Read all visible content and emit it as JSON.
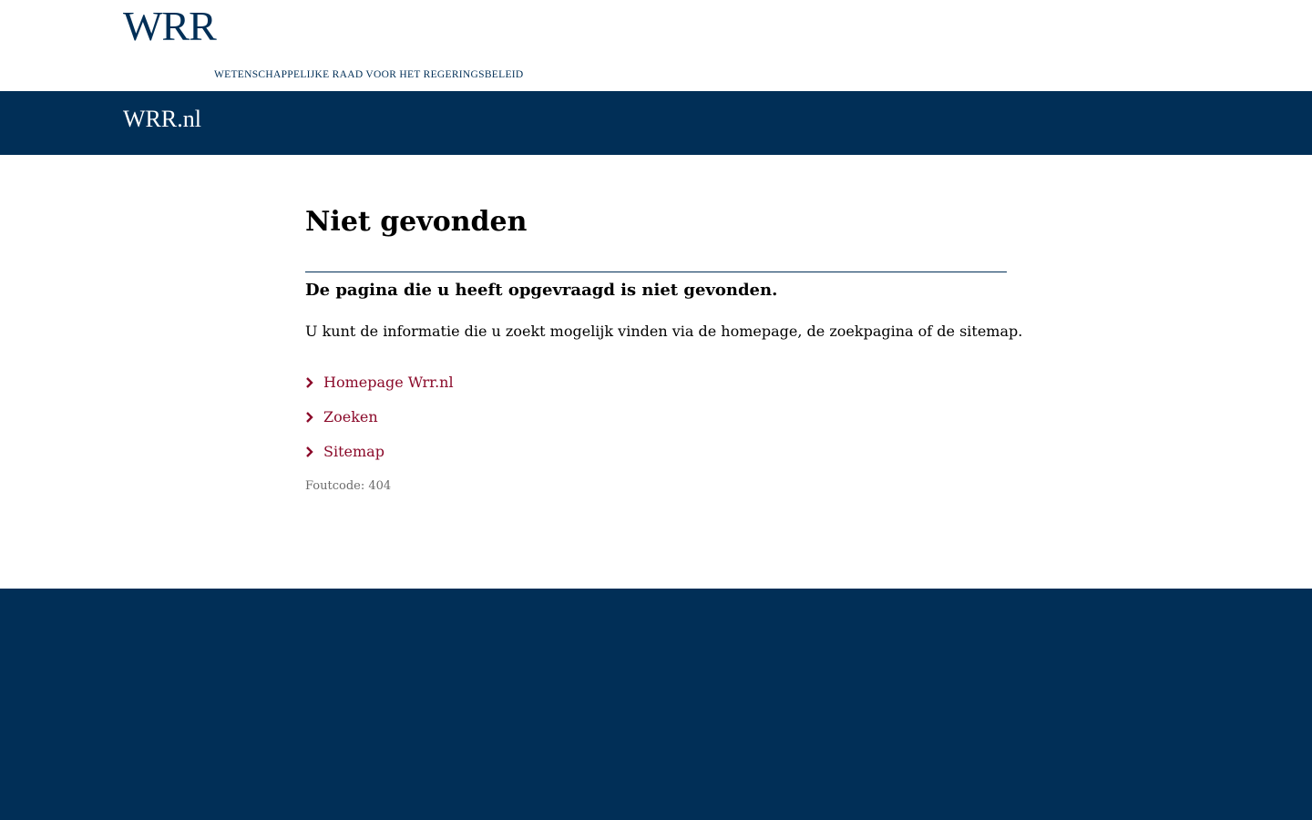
{
  "header": {
    "logo_mark": "WRR",
    "logo_subtitle": "WETENSCHAPPELIJKE RAAD VOOR HET REGERINGSBELEID"
  },
  "nav": {
    "site_name": "WRR.nl"
  },
  "main": {
    "title": "Niet gevonden",
    "lead": "De pagina die u heeft opgevraagd is niet gevonden.",
    "intro": "U kunt de informatie die u zoekt mogelijk vinden via de homepage, de zoekpagina of de sitemap.",
    "links": [
      {
        "label": "Homepage Wrr.nl",
        "icon": "chevron-right-icon"
      },
      {
        "label": "Zoeken",
        "icon": "chevron-right-icon"
      },
      {
        "label": "Sitemap",
        "icon": "chevron-right-icon"
      }
    ],
    "error_code": "Foutcode: 404"
  },
  "colors": {
    "brand": "#012f57",
    "link": "#8b0a2a",
    "muted": "#6b6b6b"
  }
}
